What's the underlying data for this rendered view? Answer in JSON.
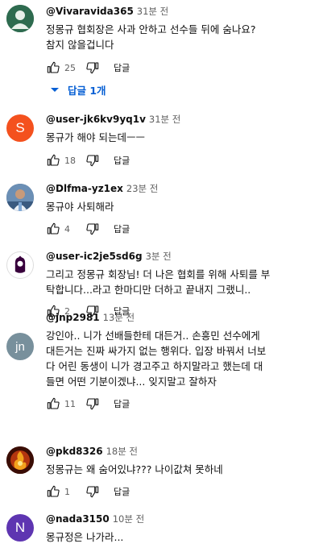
{
  "comments": [
    {
      "handle": "@Vivaravida365",
      "time": "31분 전",
      "text_lines": [
        "정몽규 협회장은 사과 안하고 선수들  뒤에 숨나요?",
        "참지 않을겁니다"
      ],
      "likes": "25",
      "reply_label": "답글",
      "avatar_letter": "",
      "avatar_color": "#2e6b4f"
    },
    {
      "handle": "@user-jk6kv9yq1v",
      "time": "31분 전",
      "text_lines": [
        "몽규가 해야 되는데ㅡㅡ"
      ],
      "likes": "18",
      "reply_label": "답글",
      "avatar_letter": "S",
      "avatar_color": "#f4511e"
    },
    {
      "handle": "@Dlfma-yz1ex",
      "time": "23분 전",
      "text_lines": [
        "몽규야 사퇴해라"
      ],
      "likes": "4",
      "reply_label": "답글",
      "avatar_letter": "",
      "avatar_color": "#3a5a80"
    },
    {
      "handle": "@user-ic2je5sd6g",
      "time": "3분 전",
      "text_lines": [
        "그리고 정몽규 회장님! 더 나은 협회를 위해 사퇴를 부",
        "탁합니다...라고 한마디만 더하고 끝내지 그랬니.."
      ],
      "likes": "2",
      "reply_label": "답글",
      "avatar_letter": "",
      "avatar_color": "#ffffff"
    },
    {
      "handle": "@jnp2981",
      "time": "13분 전",
      "text_lines": [
        "강인아.. 니가 선배들한테 대든거.. 손흥민 선수에게",
        "대든거는 진짜 싸가지 없는 행위다. 입장 바꿔서 너보",
        "다 어린 동생이 니가 경고주고 하지말라고 했는데 대",
        "들면  어떤 기분이겠냐... 잊지말고 잘하자"
      ],
      "likes": "11",
      "reply_label": "답글",
      "avatar_letter": "jn",
      "avatar_color": "#78909c"
    },
    {
      "handle": "@pkd8326",
      "time": "18분 전",
      "text_lines": [
        "정몽규는 왜 숨어있냐??? 나이값쳐 못하네"
      ],
      "likes": "1",
      "reply_label": "답글",
      "avatar_letter": "",
      "avatar_color": "#5a1a0a"
    },
    {
      "handle": "@nada3150",
      "time": "10분 전",
      "text_lines": [
        "몽규정은 나가라..."
      ],
      "likes": "",
      "reply_label": "",
      "avatar_letter": "N",
      "avatar_color": "#5e35b1"
    }
  ],
  "replies_toggle": {
    "label": "답글 1개",
    "color": "#065fd4"
  }
}
